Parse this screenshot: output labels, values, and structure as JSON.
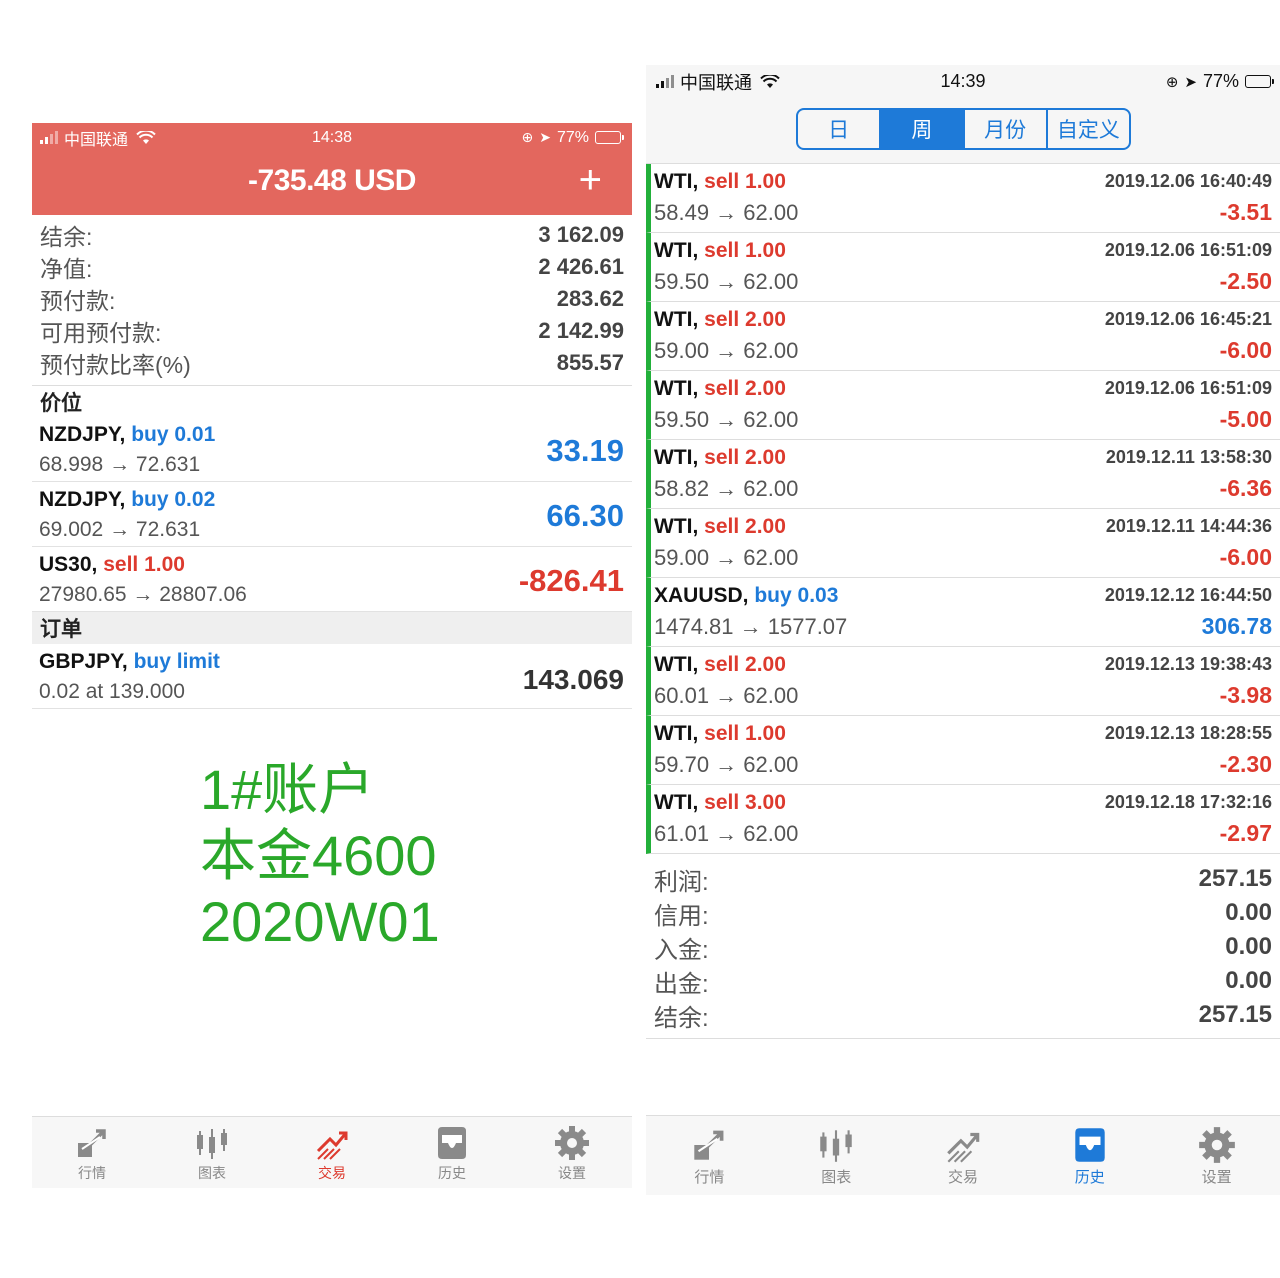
{
  "left": {
    "status": {
      "carrier": "中国联通",
      "time": "14:38",
      "battery": "77%"
    },
    "header": {
      "title": "-735.48 USD",
      "add": "+"
    },
    "summary": [
      {
        "label": "结余:",
        "value": "3 162.09"
      },
      {
        "label": "净值:",
        "value": "2 426.61"
      },
      {
        "label": "预付款:",
        "value": "283.62"
      },
      {
        "label": "可用预付款:",
        "value": "2 142.99"
      },
      {
        "label": "预付款比率(%)",
        "value": "855.57"
      }
    ],
    "positions_title": "价位",
    "positions": [
      {
        "symbol": "NZDJPY,",
        "side": "buy 0.01",
        "prices": "68.998 → 72.631",
        "profit": "33.19",
        "side_color": "blue",
        "profit_color": "blue"
      },
      {
        "symbol": "NZDJPY,",
        "side": "buy 0.02",
        "prices": "69.002 → 72.631",
        "profit": "66.30",
        "side_color": "blue",
        "profit_color": "blue"
      },
      {
        "symbol": "US30,",
        "side": "sell 1.00",
        "prices": "27980.65 → 28807.06",
        "profit": "-826.41",
        "side_color": "red",
        "profit_color": "red"
      }
    ],
    "orders_title": "订单",
    "orders": [
      {
        "symbol": "GBPJPY,",
        "side": "buy limit",
        "prices": "0.02 at 139.000",
        "price": "143.069"
      }
    ],
    "note": [
      "1#账户",
      "本金4600",
      "2020W01"
    ],
    "tabs": [
      {
        "label": "行情",
        "icon": "quotes-icon"
      },
      {
        "label": "图表",
        "icon": "chart-icon"
      },
      {
        "label": "交易",
        "icon": "trade-icon",
        "active": true
      },
      {
        "label": "历史",
        "icon": "history-icon"
      },
      {
        "label": "设置",
        "icon": "settings-icon"
      }
    ]
  },
  "right": {
    "status": {
      "carrier": "中国联通",
      "time": "14:39",
      "battery": "77%"
    },
    "segments": [
      {
        "label": "日"
      },
      {
        "label": "周",
        "active": true
      },
      {
        "label": "月份"
      },
      {
        "label": "自定义"
      }
    ],
    "deals": [
      {
        "symbol": "WTI,",
        "side": "sell 1.00",
        "prices": "58.49 → 62.00",
        "time": "2019.12.06 16:40:49",
        "profit": "-3.51",
        "side_color": "red",
        "profit_color": "red"
      },
      {
        "symbol": "WTI,",
        "side": "sell 1.00",
        "prices": "59.50 → 62.00",
        "time": "2019.12.06 16:51:09",
        "profit": "-2.50",
        "side_color": "red",
        "profit_color": "red"
      },
      {
        "symbol": "WTI,",
        "side": "sell 2.00",
        "prices": "59.00 → 62.00",
        "time": "2019.12.06 16:45:21",
        "profit": "-6.00",
        "side_color": "red",
        "profit_color": "red"
      },
      {
        "symbol": "WTI,",
        "side": "sell 2.00",
        "prices": "59.50 → 62.00",
        "time": "2019.12.06 16:51:09",
        "profit": "-5.00",
        "side_color": "red",
        "profit_color": "red"
      },
      {
        "symbol": "WTI,",
        "side": "sell 2.00",
        "prices": "58.82 → 62.00",
        "time": "2019.12.11 13:58:30",
        "profit": "-6.36",
        "side_color": "red",
        "profit_color": "red"
      },
      {
        "symbol": "WTI,",
        "side": "sell 2.00",
        "prices": "59.00 → 62.00",
        "time": "2019.12.11 14:44:36",
        "profit": "-6.00",
        "side_color": "red",
        "profit_color": "red"
      },
      {
        "symbol": "XAUUSD,",
        "side": "buy 0.03",
        "prices": "1474.81 → 1577.07",
        "time": "2019.12.12 16:44:50",
        "profit": "306.78",
        "side_color": "blue",
        "profit_color": "blue"
      },
      {
        "symbol": "WTI,",
        "side": "sell 2.00",
        "prices": "60.01 → 62.00",
        "time": "2019.12.13 19:38:43",
        "profit": "-3.98",
        "side_color": "red",
        "profit_color": "red"
      },
      {
        "symbol": "WTI,",
        "side": "sell 1.00",
        "prices": "59.70 → 62.00",
        "time": "2019.12.13 18:28:55",
        "profit": "-2.30",
        "side_color": "red",
        "profit_color": "red"
      },
      {
        "symbol": "WTI,",
        "side": "sell 3.00",
        "prices": "61.01 → 62.00",
        "time": "2019.12.18 17:32:16",
        "profit": "-2.97",
        "side_color": "red",
        "profit_color": "red"
      }
    ],
    "totals": [
      {
        "label": "利润:",
        "value": "257.15"
      },
      {
        "label": "信用:",
        "value": "0.00"
      },
      {
        "label": "入金:",
        "value": "0.00"
      },
      {
        "label": "出金:",
        "value": "0.00"
      },
      {
        "label": "结余:",
        "value": "257.15"
      }
    ],
    "tabs": [
      {
        "label": "行情",
        "icon": "quotes-icon"
      },
      {
        "label": "图表",
        "icon": "chart-icon"
      },
      {
        "label": "交易",
        "icon": "trade-icon"
      },
      {
        "label": "历史",
        "icon": "history-icon",
        "active": true
      },
      {
        "label": "设置",
        "icon": "settings-icon"
      }
    ]
  },
  "colors": {
    "header_red": "#e3675e",
    "profit_blue": "#1e7ad8",
    "loss_red": "#dd3a2e",
    "deal_bar_green": "#22b03a",
    "note_green": "#2aa82a"
  }
}
